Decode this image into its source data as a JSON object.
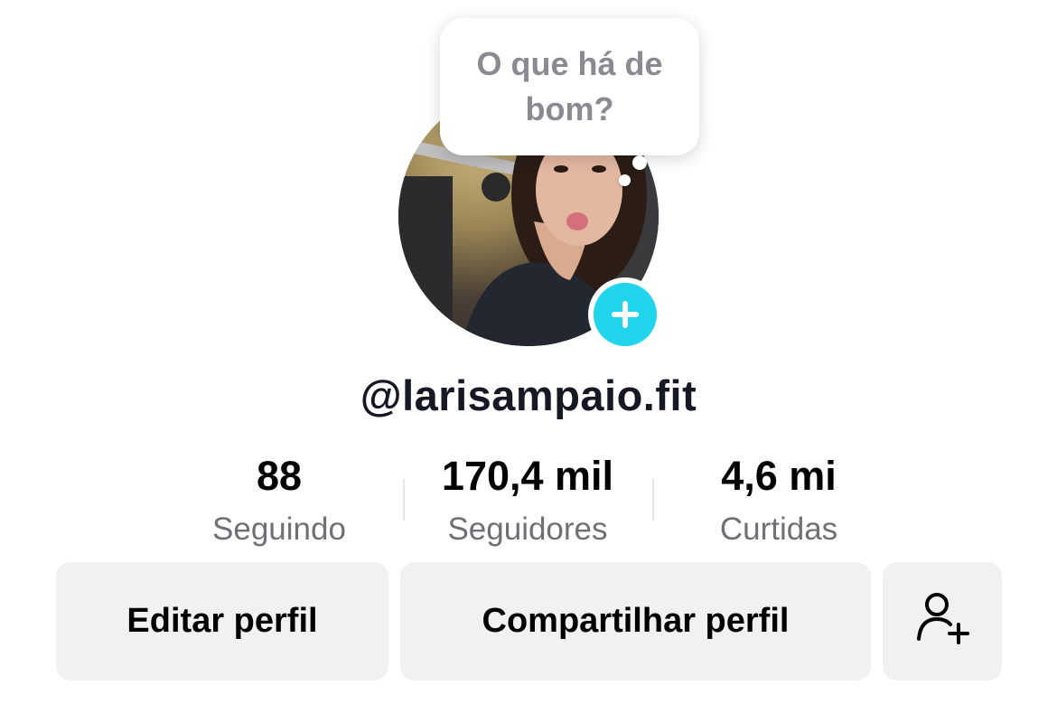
{
  "profile": {
    "username": "@larisampaio.fit",
    "note_bubble": "O que há de bom?"
  },
  "stats": {
    "following": {
      "value": "88",
      "label": "Seguindo"
    },
    "followers": {
      "value": "170,4 mil",
      "label": "Seguidores"
    },
    "likes": {
      "value": "4,6 mi",
      "label": "Curtidas"
    }
  },
  "actions": {
    "edit_label": "Editar perfil",
    "share_label": "Compartilhar perfil",
    "add_friend_icon": "add-user-icon"
  },
  "colors": {
    "accent": "#20d5ec",
    "button_bg": "#f1f1f3",
    "muted_text": "#6f7075"
  }
}
